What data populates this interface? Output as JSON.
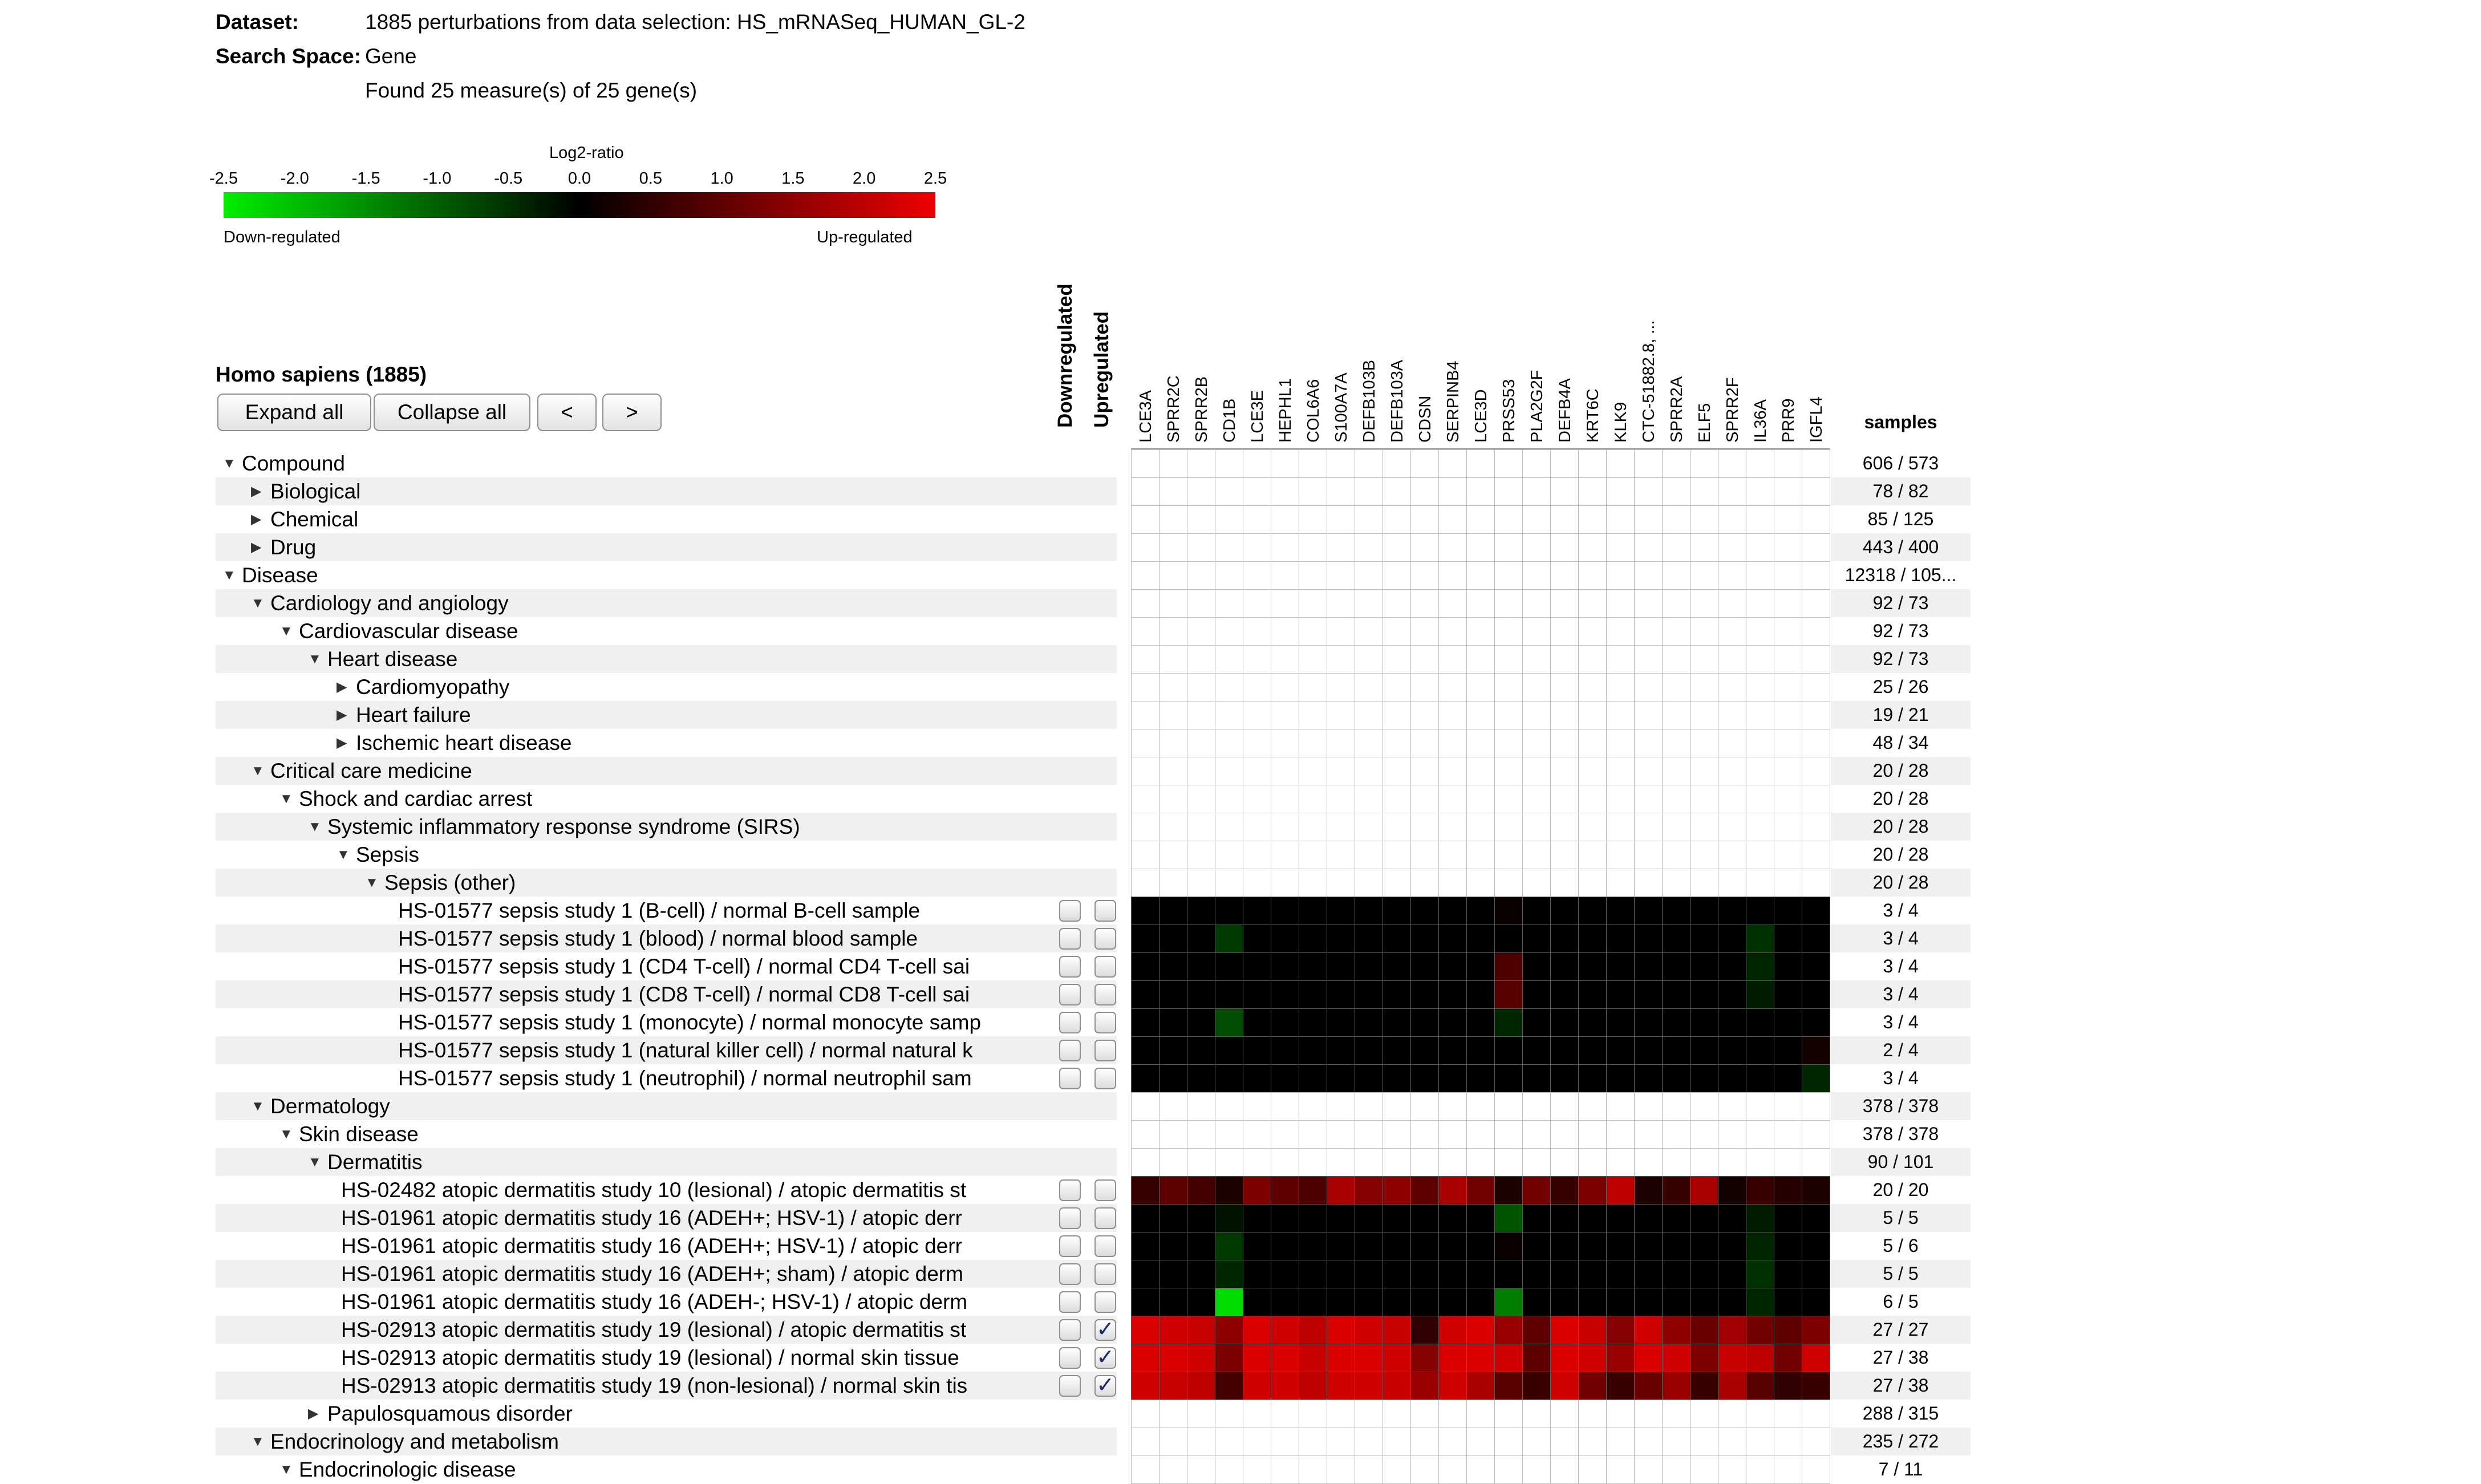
{
  "info": {
    "dataset_label": "Dataset:",
    "dataset_value": "1885 perturbations from data selection: HS_mRNASeq_HUMAN_GL-2",
    "search_label": "Search Space:",
    "search_value": "Gene",
    "found_text": "Found 25 measure(s) of 25 gene(s)"
  },
  "colorscale": {
    "title": "Log2-ratio",
    "ticks": [
      "-2.5",
      "-2.0",
      "-1.5",
      "-1.0",
      "-0.5",
      "0.0",
      "0.5",
      "1.0",
      "1.5",
      "2.0",
      "2.5"
    ],
    "down_label": "Down-regulated",
    "up_label": "Up-regulated",
    "colors": {
      "down": "#00ee00",
      "zero": "#000000",
      "up": "#ee0000"
    }
  },
  "tree": {
    "title": "Homo sapiens (1885)",
    "buttons": {
      "expand": "Expand all",
      "collapse": "Collapse all",
      "prev": "<",
      "next": ">"
    }
  },
  "columns": {
    "downregulated": "Downregulated",
    "upregulated": "Upregulated",
    "samples": "samples"
  },
  "genes": [
    "LCE3A",
    "SPRR2C",
    "SPRR2B",
    "CD1B",
    "LCE3E",
    "HEPHL1",
    "COL6A6",
    "S100A7A",
    "DEFB103B",
    "DEFB103A",
    "CDSN",
    "SERPINB4",
    "LCE3D",
    "PRSS53",
    "PLA2G2F",
    "DEFB4A",
    "KRT6C",
    "KLK9",
    "CTC-51882.8, ...",
    "SPRR2A",
    "ELF5",
    "SPRR2F",
    "IL36A",
    "PRR9",
    "IGFL4"
  ],
  "rows": [
    {
      "label": "Compound",
      "level": 0,
      "node": "expanded",
      "samples": "606 / 573"
    },
    {
      "label": "Biological",
      "level": 1,
      "node": "collapsed",
      "samples": "78 / 82"
    },
    {
      "label": "Chemical",
      "level": 1,
      "node": "collapsed",
      "samples": "85 / 125"
    },
    {
      "label": "Drug",
      "level": 1,
      "node": "collapsed",
      "samples": "443 / 400"
    },
    {
      "label": "Disease",
      "level": 0,
      "node": "expanded",
      "samples": "12318 / 105..."
    },
    {
      "label": "Cardiology and angiology",
      "level": 1,
      "node": "expanded",
      "samples": "92 / 73"
    },
    {
      "label": "Cardiovascular disease",
      "level": 2,
      "node": "expanded",
      "samples": "92 / 73"
    },
    {
      "label": "Heart disease",
      "level": 3,
      "node": "expanded",
      "samples": "92 / 73"
    },
    {
      "label": "Cardiomyopathy",
      "level": 4,
      "node": "collapsed",
      "samples": "25 / 26"
    },
    {
      "label": "Heart failure",
      "level": 4,
      "node": "collapsed",
      "samples": "19 / 21"
    },
    {
      "label": "Ischemic heart disease",
      "level": 4,
      "node": "collapsed",
      "samples": "48 / 34"
    },
    {
      "label": "Critical care medicine",
      "level": 1,
      "node": "expanded",
      "samples": "20 / 28"
    },
    {
      "label": "Shock and cardiac arrest",
      "level": 2,
      "node": "expanded",
      "samples": "20 / 28"
    },
    {
      "label": "Systemic inflammatory response syndrome (SIRS)",
      "level": 3,
      "node": "expanded",
      "samples": "20 / 28"
    },
    {
      "label": "Sepsis",
      "level": 4,
      "node": "expanded",
      "samples": "20 / 28"
    },
    {
      "label": "Sepsis (other)",
      "level": 5,
      "node": "expanded",
      "samples": "20 / 28"
    },
    {
      "label": "HS-01577  sepsis study 1 (B-cell) / normal B-cell sample",
      "level": 6,
      "leaf": true,
      "down": false,
      "up": false,
      "samples": "3 / 4",
      "values": [
        0,
        0,
        0,
        0,
        0,
        0,
        0,
        0,
        0,
        0,
        0,
        0,
        0,
        0.1,
        0,
        0,
        0,
        0,
        0,
        0,
        0,
        0,
        0,
        0,
        0
      ]
    },
    {
      "label": "HS-01577  sepsis study 1 (blood) / normal blood sample",
      "level": 6,
      "leaf": true,
      "down": false,
      "up": false,
      "samples": "3 / 4",
      "values": [
        0,
        0,
        0,
        -0.6,
        0,
        0,
        0,
        0,
        0,
        0,
        0,
        0,
        0,
        0,
        0,
        0,
        0,
        0,
        0,
        0,
        0,
        0,
        -0.5,
        0,
        0
      ]
    },
    {
      "label": "HS-01577  sepsis study 1 (CD4 T-cell) / normal CD4 T-cell sai",
      "level": 6,
      "leaf": true,
      "down": false,
      "up": false,
      "samples": "3 / 4",
      "values": [
        0,
        0,
        0,
        0,
        0,
        0,
        0,
        0,
        0,
        0,
        0,
        0,
        0,
        0.8,
        0,
        0,
        0,
        0,
        0,
        0,
        0,
        0,
        -0.4,
        0,
        0
      ]
    },
    {
      "label": "HS-01577  sepsis study 1 (CD8 T-cell) / normal CD8 T-cell sai",
      "level": 6,
      "leaf": true,
      "down": false,
      "up": false,
      "samples": "3 / 4",
      "values": [
        0,
        0,
        0,
        0,
        0,
        0,
        0,
        0,
        0,
        0,
        0,
        0,
        0,
        0.9,
        0,
        0,
        0,
        0,
        0,
        0,
        0,
        0,
        -0.3,
        0,
        0
      ]
    },
    {
      "label": "HS-01577  sepsis study 1 (monocyte) / normal monocyte samp",
      "level": 6,
      "leaf": true,
      "down": false,
      "up": false,
      "samples": "3 / 4",
      "values": [
        0,
        0,
        0,
        -0.8,
        0,
        0,
        0,
        0,
        0,
        0,
        0,
        0,
        0,
        -0.4,
        0,
        0,
        0,
        0,
        0,
        0,
        0,
        0,
        0,
        0,
        0
      ]
    },
    {
      "label": "HS-01577  sepsis study 1 (natural killer cell) / normal natural k",
      "level": 6,
      "leaf": true,
      "down": false,
      "up": false,
      "samples": "2 / 4",
      "values": [
        0,
        0,
        0,
        0,
        0,
        0,
        0,
        0,
        0,
        0,
        0,
        0,
        0,
        0,
        0,
        0,
        0,
        0,
        0,
        0,
        0,
        0,
        0,
        0,
        0.2
      ]
    },
    {
      "label": "HS-01577  sepsis study 1 (neutrophil) / normal neutrophil sam",
      "level": 6,
      "leaf": true,
      "down": false,
      "up": false,
      "samples": "3 / 4",
      "values": [
        0,
        0,
        0,
        0,
        0,
        0,
        0,
        0,
        0,
        0,
        0,
        0,
        0,
        0,
        0,
        0,
        0,
        0,
        0,
        0,
        0,
        0,
        0,
        0,
        -0.4
      ]
    },
    {
      "label": "Dermatology",
      "level": 1,
      "node": "expanded",
      "samples": "378 / 378"
    },
    {
      "label": "Skin disease",
      "level": 2,
      "node": "expanded",
      "samples": "378 / 378"
    },
    {
      "label": "Dermatitis",
      "level": 3,
      "node": "expanded",
      "samples": "90 / 101"
    },
    {
      "label": "HS-02482  atopic dermatitis study 10 (lesional) / atopic dermatitis st",
      "level": 4,
      "leaf": true,
      "down": false,
      "up": false,
      "samples": "20 / 20",
      "values": [
        0.6,
        1.0,
        0.7,
        0.3,
        1.3,
        1.0,
        0.8,
        1.8,
        1.4,
        1.5,
        1.0,
        1.8,
        1.2,
        0.3,
        1.2,
        0.6,
        1.3,
        2.0,
        0.3,
        0.6,
        1.8,
        0.2,
        0.6,
        0.4,
        0.3
      ]
    },
    {
      "label": "HS-01961  atopic dermatitis study 16 (ADEH+; HSV-1) / atopic derr",
      "level": 4,
      "leaf": true,
      "down": false,
      "up": false,
      "samples": "5 / 5",
      "values": [
        0,
        0,
        0,
        -0.2,
        0,
        0,
        0,
        0,
        0,
        0,
        0,
        0,
        0,
        -0.9,
        0,
        0,
        0,
        0,
        0,
        0,
        0,
        0,
        -0.3,
        0,
        0
      ]
    },
    {
      "label": "HS-01961  atopic dermatitis study 16 (ADEH+; HSV-1) / atopic derr",
      "level": 4,
      "leaf": true,
      "down": false,
      "up": false,
      "samples": "5 / 6",
      "values": [
        0,
        0,
        0,
        -0.6,
        0,
        0,
        0,
        0,
        0,
        0,
        0,
        0,
        0,
        0.1,
        0,
        0,
        0,
        0,
        0,
        0,
        0,
        0,
        -0.4,
        0,
        0
      ]
    },
    {
      "label": "HS-01961  atopic dermatitis study 16 (ADEH+; sham) / atopic derm",
      "level": 4,
      "leaf": true,
      "down": false,
      "up": false,
      "samples": "5 / 5",
      "values": [
        0,
        0,
        0,
        -0.4,
        0,
        0,
        0,
        0,
        0,
        0,
        0,
        0,
        0,
        0,
        0,
        0,
        0,
        0,
        0,
        0,
        0,
        0,
        -0.5,
        0,
        0
      ]
    },
    {
      "label": "HS-01961  atopic dermatitis study 16 (ADEH-; HSV-1) / atopic derm",
      "level": 4,
      "leaf": true,
      "down": false,
      "up": false,
      "samples": "6 / 5",
      "values": [
        0,
        0,
        0,
        -2.3,
        0,
        0,
        0,
        0,
        0,
        0,
        0,
        0,
        0,
        -1.3,
        0,
        0,
        0,
        0,
        0,
        0,
        0,
        0,
        -0.4,
        0,
        0
      ]
    },
    {
      "label": "HS-02913  atopic dermatitis study 19 (lesional) / atopic dermatitis st",
      "level": 4,
      "leaf": true,
      "down": false,
      "up": true,
      "samples": "27 / 27",
      "values": [
        2.3,
        2.2,
        2.1,
        1.5,
        2.3,
        2.2,
        2.0,
        2.3,
        2.2,
        2.1,
        0.5,
        2.2,
        2.3,
        1.6,
        1.0,
        2.3,
        2.1,
        1.4,
        2.2,
        1.5,
        1.1,
        1.7,
        1.2,
        1.0,
        1.3
      ]
    },
    {
      "label": "HS-02913  atopic dermatitis study 19 (lesional) / normal skin tissue",
      "level": 4,
      "leaf": true,
      "down": false,
      "up": true,
      "samples": "27 / 38",
      "values": [
        2.3,
        2.3,
        2.2,
        1.3,
        2.3,
        2.3,
        2.1,
        2.3,
        2.3,
        2.2,
        1.4,
        2.3,
        2.3,
        2.2,
        1.0,
        2.3,
        2.2,
        1.6,
        2.3,
        2.2,
        1.3,
        2.1,
        2.0,
        1.2,
        2.2
      ]
    },
    {
      "label": "HS-02913  atopic dermatitis study 19 (non-lesional) / normal skin tis",
      "level": 4,
      "leaf": true,
      "down": false,
      "up": true,
      "samples": "27 / 38",
      "values": [
        2.2,
        2.1,
        2.0,
        0.7,
        2.2,
        2.2,
        2.0,
        2.2,
        2.2,
        2.1,
        1.6,
        2.2,
        1.8,
        0.9,
        0.6,
        2.2,
        1.2,
        0.6,
        1.1,
        1.6,
        0.6,
        1.8,
        0.9,
        0.5,
        0.6
      ]
    },
    {
      "label": "Papulosquamous disorder",
      "level": 3,
      "node": "collapsed",
      "samples": "288 / 315"
    },
    {
      "label": "Endocrinology and metabolism",
      "level": 1,
      "node": "expanded",
      "samples": "235 / 272"
    },
    {
      "label": "Endocrinologic disease",
      "level": 2,
      "node": "expanded",
      "samples": "7 / 11"
    }
  ]
}
